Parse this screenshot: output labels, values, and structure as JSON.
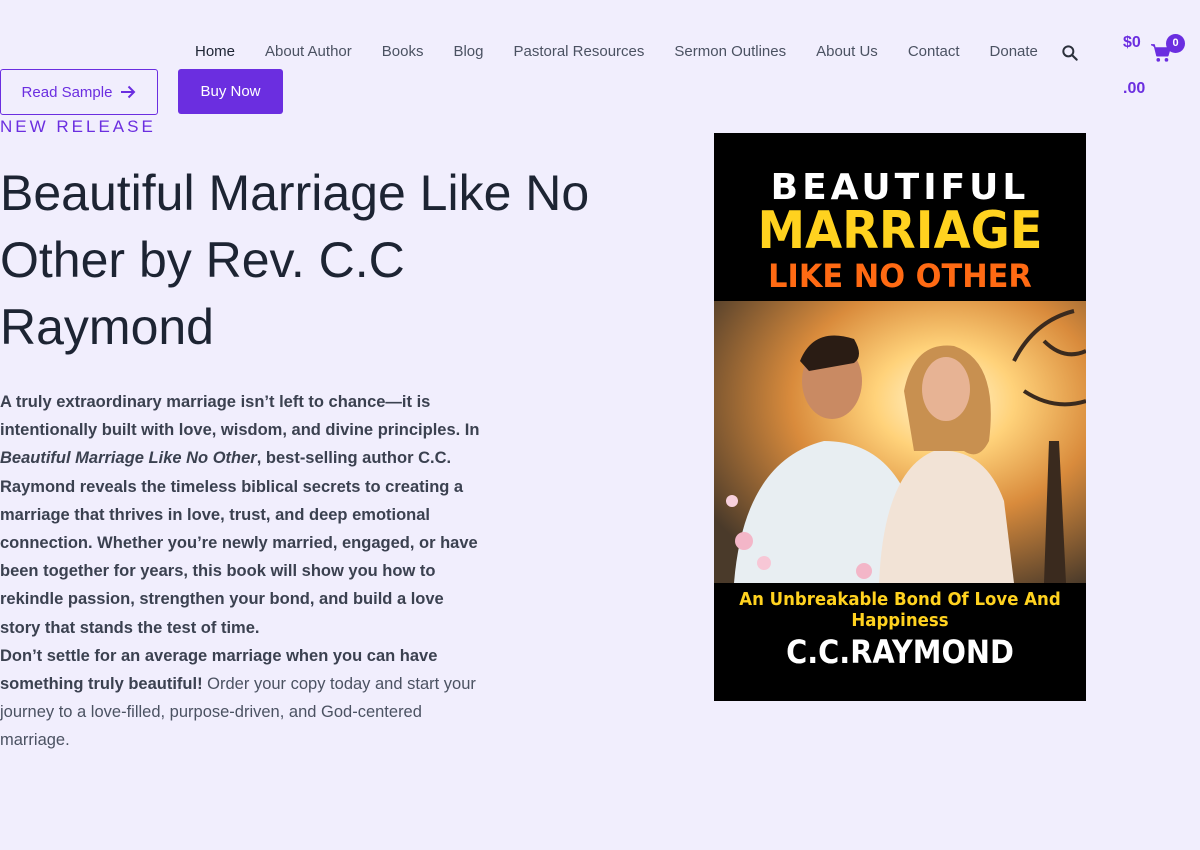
{
  "nav": {
    "items": [
      {
        "label": "Home",
        "active": true
      },
      {
        "label": "About Author"
      },
      {
        "label": "Books"
      },
      {
        "label": "Blog"
      },
      {
        "label": "Pastoral Resources"
      },
      {
        "label": "Sermon Outlines"
      },
      {
        "label": "About Us"
      },
      {
        "label": "Contact"
      },
      {
        "label": "Donate"
      }
    ],
    "search_icon": "search-icon"
  },
  "cart": {
    "amount_line1": "$0",
    "amount_line2": ".00",
    "count": "0",
    "icon": "cart-icon"
  },
  "hero": {
    "read_sample_label": "Read Sample",
    "read_sample_icon": "arrow-right-icon",
    "buy_now_label": "Buy Now",
    "eyebrow": "NEW RELEASE",
    "title": "Beautiful Marriage Like No Other by Rev. C.C Raymond",
    "description": {
      "p1_start": "A truly extraordinary marriage isn’t left to chance—it is intentionally built with love, wisdom, and divine principles. In ",
      "p1_italic": "Beautiful Marriage Like No Other",
      "p1_end": ", best-selling author C.C. Raymond reveals the timeless biblical secrets to creating a marriage that thrives in love, trust, and deep emotional connection. Whether you’re newly married, engaged, or have been together for years, this book will show you how to rekindle passion, strengthen your bond, and build a love story that stands the test of time.",
      "p2_bold": "Don’t settle for an average marriage when you can have something truly beautiful!",
      "p2_normal": " Order your copy today and start your journey to a love-filled, purpose-driven, and God-centered marriage."
    }
  },
  "cover": {
    "line1": "BEAUTIFUL",
    "line2": "MARRIAGE",
    "line3": "LIKE NO OTHER",
    "tagline": "An Unbreakable Bond Of Love And Happiness",
    "author": "C.C.RAYMOND",
    "colors": {
      "white": "#ffffff",
      "yellow": "#ffd21f",
      "orange": "#ff6a13"
    }
  },
  "colors": {
    "accent": "#6b2ee0",
    "background": "#f1eefd",
    "text": "#1d2433"
  }
}
